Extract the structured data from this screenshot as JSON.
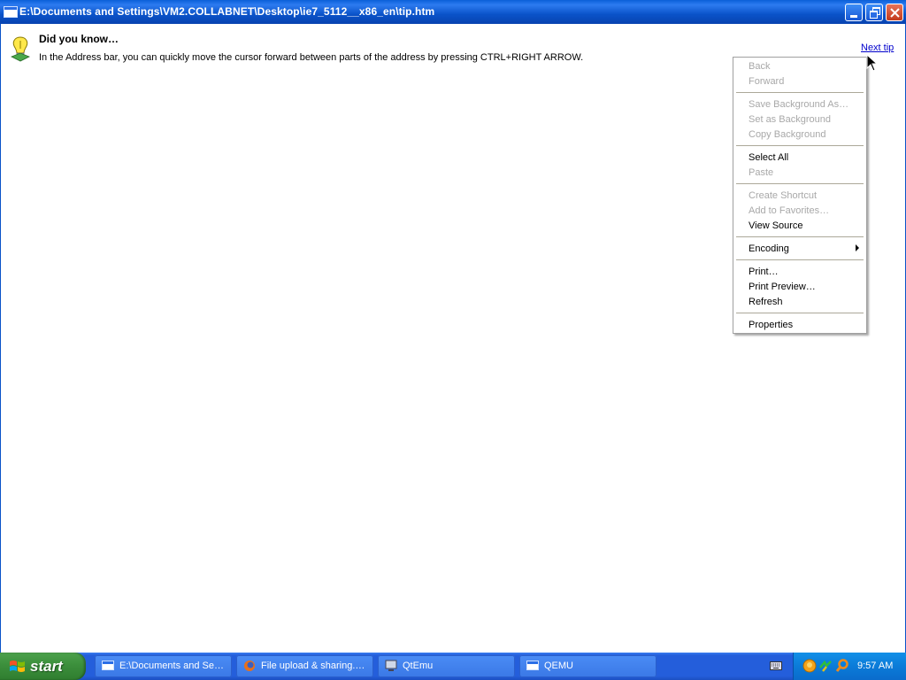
{
  "window": {
    "title": "E:\\Documents and Settings\\VM2.COLLABNET\\Desktop\\ie7_5112__x86_en\\tip.htm"
  },
  "tip": {
    "heading": "Did you know…",
    "text": "In the Address bar, you can quickly move the cursor forward between parts of the address by pressing CTRL+RIGHT ARROW.",
    "next_link": "Next tip"
  },
  "context_menu": {
    "items": [
      {
        "label": "Back",
        "enabled": false
      },
      {
        "label": "Forward",
        "enabled": false
      },
      {
        "label": "Save Background As…",
        "enabled": false
      },
      {
        "label": "Set as Background",
        "enabled": false
      },
      {
        "label": "Copy Background",
        "enabled": false
      },
      {
        "label": "Select All",
        "enabled": true
      },
      {
        "label": "Paste",
        "enabled": false
      },
      {
        "label": "Create Shortcut",
        "enabled": false
      },
      {
        "label": "Add to Favorites…",
        "enabled": false
      },
      {
        "label": "View Source",
        "enabled": true
      },
      {
        "label": "Encoding",
        "enabled": true,
        "submenu": true
      },
      {
        "label": "Print…",
        "enabled": true
      },
      {
        "label": "Print Preview…",
        "enabled": true
      },
      {
        "label": "Refresh",
        "enabled": true
      },
      {
        "label": "Properties",
        "enabled": true
      }
    ]
  },
  "taskbar": {
    "start_label": "start",
    "tasks": [
      {
        "label": "E:\\Documents and Se…",
        "icon": "window-icon"
      },
      {
        "label": "File upload & sharing.…",
        "icon": "firefox-icon"
      },
      {
        "label": "QtEmu",
        "icon": "qtemu-icon"
      },
      {
        "label": "QEMU",
        "icon": "window-icon"
      }
    ],
    "clock": "9:57 AM"
  },
  "colors": {
    "titlebar": "#0a53c9",
    "start_button": "#3c8f3c",
    "link": "#0000cc",
    "disabled_text": "#a8a8a8"
  }
}
